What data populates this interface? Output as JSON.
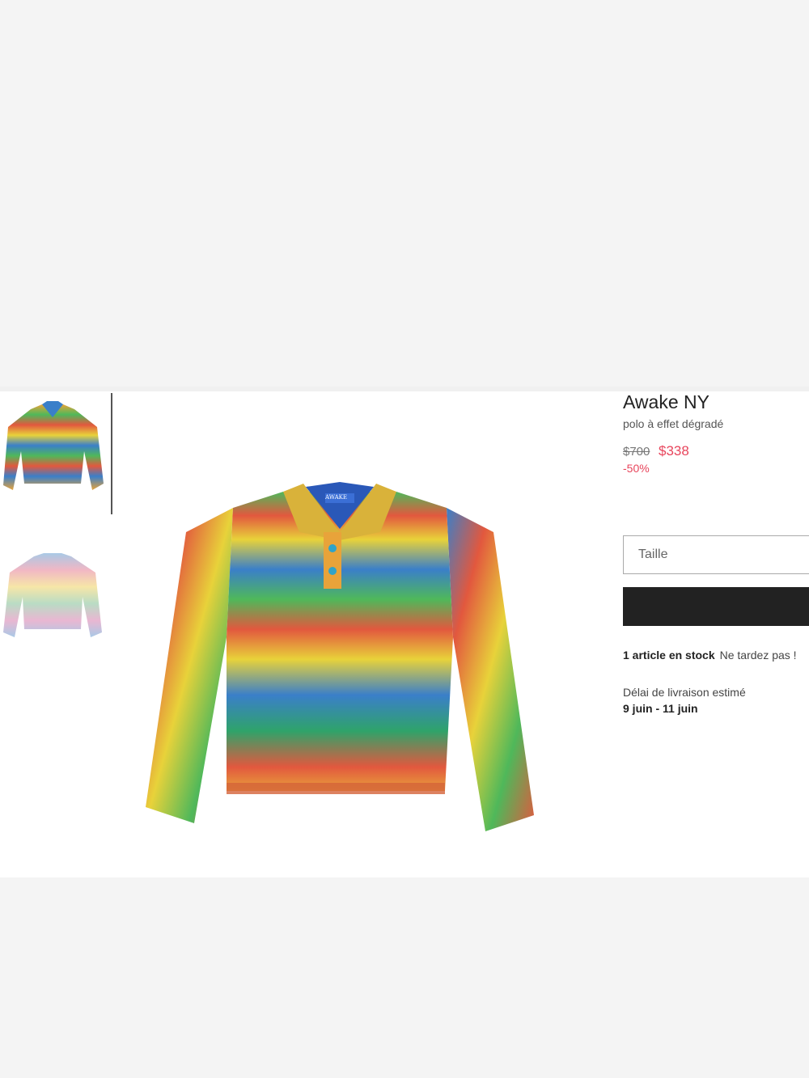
{
  "product": {
    "brand": "Awake NY",
    "subtitle": "polo à effet dégradé",
    "price_old": "$700",
    "price_new": "$338",
    "discount": "-50%",
    "label_text": "AWAKE"
  },
  "size_select": {
    "placeholder": "Taille"
  },
  "stock": {
    "count_text": "1 article en stock",
    "note": "Ne tardez pas !"
  },
  "delivery": {
    "label": "Délai de livraison estimé",
    "dates": "9 juin - 11 juin"
  },
  "gallery": {
    "thumbnails": [
      {
        "name": "rainbow polo thumbnail"
      },
      {
        "name": "pastel sweater thumbnail"
      }
    ],
    "selected_index": 0
  },
  "colors": {
    "accent_price": "#e8455c",
    "button": "#222222",
    "stripes": [
      "#e2583e",
      "#e8a33a",
      "#e8d23a",
      "#4fb85a",
      "#3a7fc9",
      "#2fa36a"
    ],
    "pastel_stripes": [
      "#f1b7c4",
      "#f6e6a8",
      "#b9dcc4",
      "#a9c9e6",
      "#e9b7d2"
    ]
  }
}
